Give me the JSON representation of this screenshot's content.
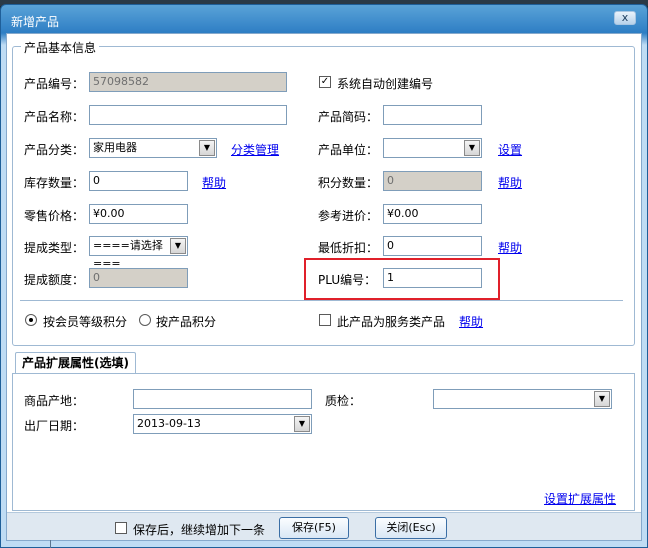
{
  "window": {
    "title": "新增产品",
    "close_label": "x"
  },
  "basic": {
    "group_title": "产品基本信息",
    "product_code_label": "产品编号：",
    "product_code_value": "57098582",
    "auto_code_label": "系统自动创建编号",
    "product_name_label": "产品名称：",
    "product_name_value": "",
    "short_name_label": "产品简码：",
    "short_name_value": "",
    "category_label": "产品分类：",
    "category_value": "家用电器",
    "category_manage_link": "分类管理",
    "unit_label": "产品单位：",
    "unit_value": "",
    "unit_setting_link": "设置",
    "stock_label": "库存数量：",
    "stock_value": "0",
    "stock_help_link": "帮助",
    "points_label": "积分数量：",
    "points_value": "0",
    "points_help_link": "帮助",
    "retail_label": "零售价格：",
    "retail_value": "¥0.00",
    "purchase_label": "参考进价：",
    "purchase_value": "¥0.00",
    "commission_type_label": "提成类型：",
    "commission_type_value": "====请选择===",
    "min_discount_label": "最低折扣：",
    "min_discount_value": "0",
    "min_discount_help_link": "帮助",
    "commission_amount_label": "提成额度：",
    "commission_amount_value": "0",
    "plu_label": "PLU编号：",
    "plu_value": "1",
    "radio_member_level": "按会员等级积分",
    "radio_product": "按产品积分",
    "service_product_label": "此产品为服务类产品",
    "service_help_link": "帮助"
  },
  "extended": {
    "tab_label": "产品扩展属性(选填)",
    "origin_label": "商品产地：",
    "origin_value": "",
    "quality_label": "质检：",
    "quality_value": "",
    "mfg_date_label": "出厂日期：",
    "mfg_date_value": "2013-09-13",
    "setup_link": "设置扩展属性"
  },
  "footer": {
    "continue_label": "保存后，继续增加下一条",
    "save_button": "保存(F5)",
    "close_button": "关闭(Esc)"
  }
}
